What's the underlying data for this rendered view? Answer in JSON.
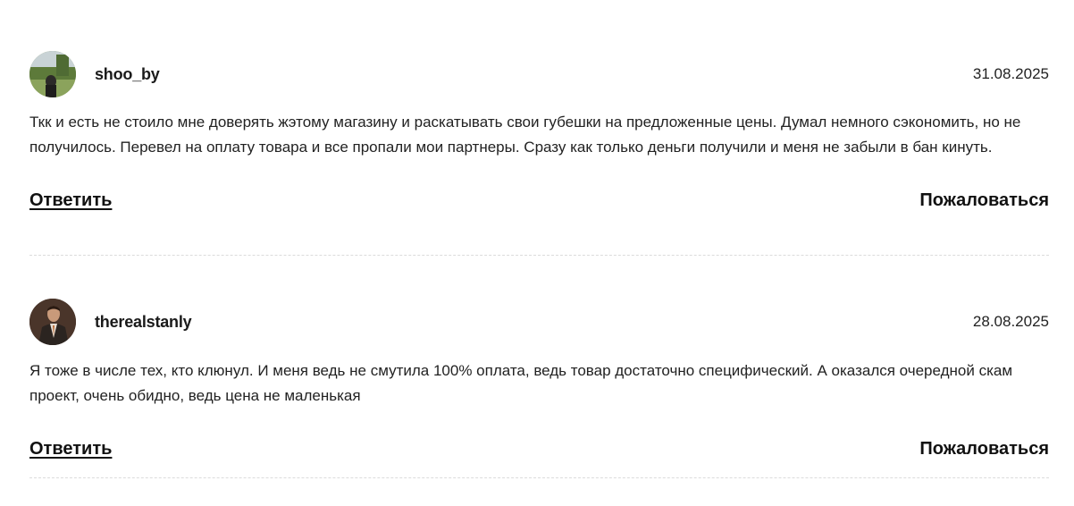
{
  "comments": [
    {
      "username": "shoo_by",
      "date": "31.08.2025",
      "text": "Ткк и есть не стоило мне доверять жэтому магазину и раскатывать свои губешки на предложенные цены. Думал немного сэкономить, но не получилось. Перевел на оплату товара и все пропали мои партнеры. Сразу как только деньги получили и меня не забыли в бан кинуть.",
      "reply_label": "Ответить",
      "report_label": "Пожаловаться"
    },
    {
      "username": "therealstanly",
      "date": "28.08.2025",
      "text": "Я тоже в числе тех, кто клюнул. И меня ведь не смутила 100% оплата, ведь товар достаточно специфический. А оказался очередной скам проект, очень обидно, ведь цена не маленькая",
      "reply_label": "Ответить",
      "report_label": "Пожаловаться"
    }
  ]
}
